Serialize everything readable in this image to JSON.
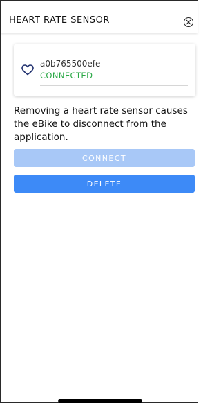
{
  "header": {
    "title": "HEART RATE SENSOR",
    "close_icon": "close-circle-icon"
  },
  "sensor": {
    "icon": "heart-icon",
    "id": "a0b765500efe",
    "status": "CONNECTED",
    "status_color": "#29a845"
  },
  "message": "Removing a heart rate sensor causes the eBike to disconnect from the application.",
  "buttons": {
    "connect_label": "CONNECT",
    "connect_color": "#a8c8f7",
    "delete_label": "DELETE",
    "delete_color": "#3d8af7"
  }
}
